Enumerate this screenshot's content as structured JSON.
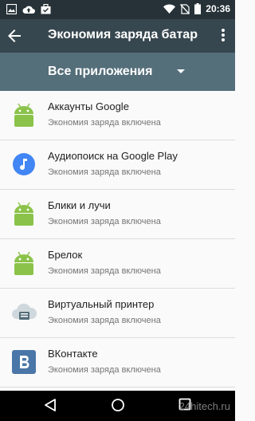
{
  "status_bar": {
    "time": "20:36",
    "left_icons": [
      "image-icon",
      "cloud-upload-icon",
      "briefcase-check-icon"
    ],
    "right_icons": [
      "wifi-icon",
      "no-sim-icon",
      "battery-icon"
    ]
  },
  "toolbar": {
    "title": "Экономия заряда батар",
    "back_icon": "arrow-back-icon",
    "menu_icon": "more-vert-icon"
  },
  "filter": {
    "selected": "Все приложения"
  },
  "apps": [
    {
      "name": "Аккаунты Google",
      "status": "Экономия заряда включена",
      "icon": "android-icon"
    },
    {
      "name": "Аудиопоиск на Google Play",
      "status": "Экономия заряда включена",
      "icon": "music-note-icon"
    },
    {
      "name": "Блики и лучи",
      "status": "Экономия заряда включена",
      "icon": "android-icon"
    },
    {
      "name": "Брелок",
      "status": "Экономия заряда включена",
      "icon": "android-icon"
    },
    {
      "name": "Виртуальный принтер",
      "status": "Экономия заряда включена",
      "icon": "cloud-print-icon"
    },
    {
      "name": "ВКонтакте",
      "status": "Экономия заряда включена",
      "icon": "vk-icon"
    }
  ],
  "nav_bar": {
    "back_icon": "nav-back-icon",
    "home_icon": "nav-home-icon",
    "recents_icon": "nav-recents-icon"
  },
  "watermark": "24hitech.ru",
  "colors": {
    "status_bar": "#263238",
    "toolbar": "#37474f",
    "filter_bar": "#546e7a",
    "android_green": "#8bc34a",
    "music_blue": "#4285f4",
    "vk_blue": "#4a76a8"
  }
}
